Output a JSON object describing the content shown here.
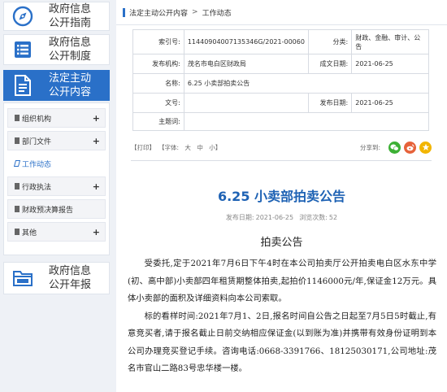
{
  "sidebar": {
    "blocks": [
      {
        "label1": "政府信息",
        "label2": "公开指南",
        "icon": "compass-icon"
      },
      {
        "label1": "政府信息",
        "label2": "公开制度",
        "icon": "list-icon"
      },
      {
        "label1": "法定主动",
        "label2": "公开内容",
        "icon": "document-icon"
      },
      {
        "label1": "政府信息",
        "label2": "公开年报",
        "icon": "folder-icon"
      }
    ],
    "items": [
      {
        "label": "组织机构",
        "expand": "+"
      },
      {
        "label": "部门文件",
        "expand": "+"
      },
      {
        "label": "工作动态",
        "expand": ""
      },
      {
        "label": "行政执法",
        "expand": "+"
      },
      {
        "label": "财政预决算报告",
        "expand": ""
      },
      {
        "label": "其他",
        "expand": "+"
      }
    ]
  },
  "breadcrumb": {
    "section": "法定主动公开内容",
    "separator": ">",
    "current": "工作动态"
  },
  "meta": {
    "index_key": "索引号:",
    "index_value": "11440904007135346G/2021-00060",
    "category_key": "分类:",
    "category_value": "财政、金融、审计、公告",
    "publisher_key": "发布机构:",
    "publisher_value": "茂名市电白区财政局",
    "created_key": "成文日期:",
    "created_value": "2021-06-25",
    "name_key": "名称:",
    "name_value": "6.25 小卖部拍卖公告",
    "docno_key": "文号:",
    "docno_value": "",
    "pubdate_key": "发布日期:",
    "pubdate_value": "2021-06-25",
    "subject_key": "主题词:",
    "subject_value": ""
  },
  "toolbar": {
    "print": "【打印】",
    "font_label": "【字体:",
    "font_large": "大",
    "font_medium": "中",
    "font_small": "小】",
    "share_label": "分享到:"
  },
  "article": {
    "title": "6.25 小卖部拍卖公告",
    "date_label": "发布日期:",
    "date_value": "2021-06-25",
    "views_label": "浏览次数:",
    "views_value": "52",
    "subhead": "拍卖公告",
    "para1": "受委托,定于2021年7月6日下午4时在本公司拍卖厅公开拍卖电白区水东中学(初、高中部)小卖部四年租赁期整体拍卖,起拍价1146000元/年,保证金12万元。具体小卖部的面积及详细资料向本公司索取。",
    "para2": "标的看样时间:2021年7月1、2日,报名时间自公告之日起至7月5日5时截止,有意竞买者,请于报名截止日前交纳相应保证金(以到账为准)并携带有效身份证明到本公司办理竞买登记手续。咨询电话:0668-3391766、18125030171,公司地址:茂名市官山二路83号忠华楼一楼。"
  },
  "colors": {
    "accent": "#2a70c8",
    "title": "#1e62b4",
    "wechat": "#3cb034",
    "weibo": "#e6623a",
    "qzone": "#f2b500"
  }
}
